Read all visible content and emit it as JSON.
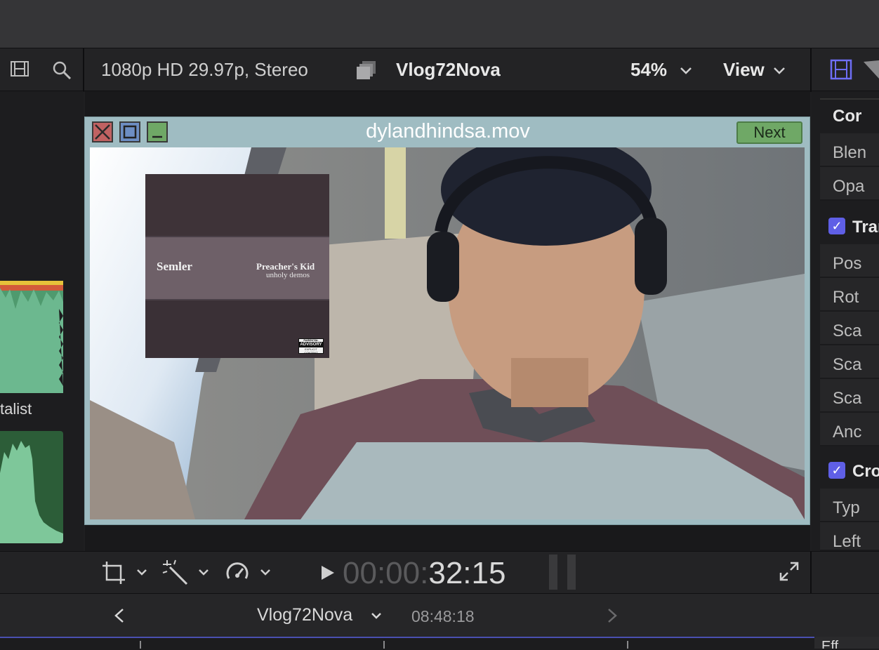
{
  "toolbar": {
    "format": "1080p HD 29.97p, Stereo",
    "project": "Vlog72Nova",
    "zoom": "54%",
    "view": "View"
  },
  "left_panel": {
    "label": "talist"
  },
  "window": {
    "title": "dylandhindsa.mov",
    "next_label": "Next"
  },
  "album": {
    "artist": "Semler",
    "title": "Preacher's Kid",
    "subtitle": "unholy demos",
    "advisory_top": "PARENTAL",
    "advisory_mid": "ADVISORY",
    "advisory_bottom": "EXPLICIT CONTENT"
  },
  "inspector": {
    "rows": [
      "Cor",
      "Blen",
      "Opa",
      "Tran",
      "Pos",
      "Rot",
      "Sca",
      "Sca",
      "Sca",
      "Anc",
      "Cro",
      "Typ",
      "Left"
    ]
  },
  "transport": {
    "timecode_dim": "00:00:",
    "timecode": "32:15"
  },
  "timeline": {
    "project": "Vlog72Nova",
    "duration": "08:48:18",
    "effects_label": "Eff"
  }
}
